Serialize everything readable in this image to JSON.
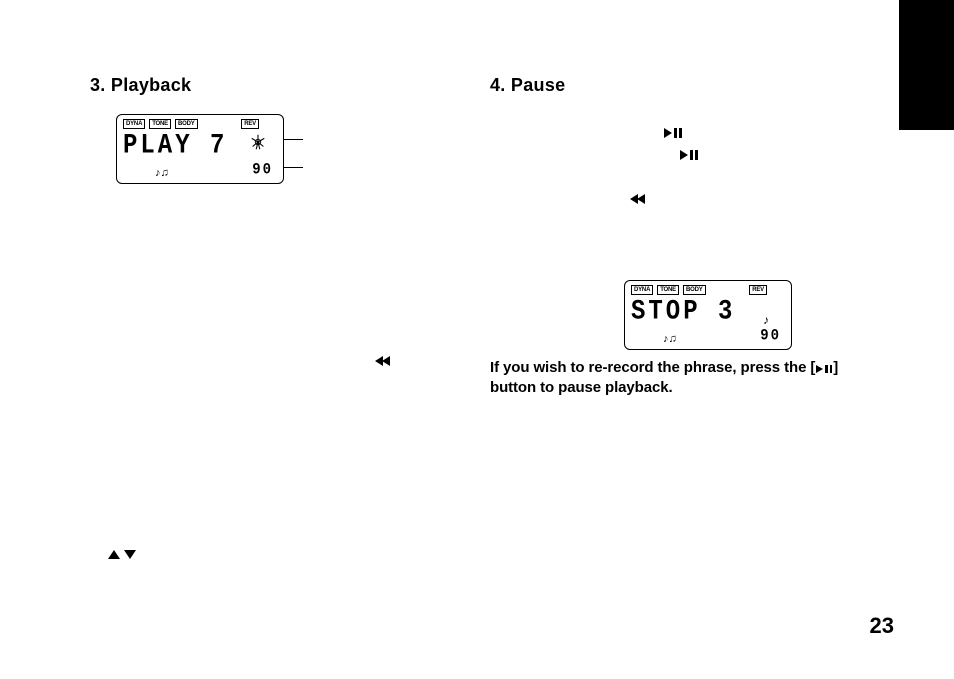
{
  "page_number": "23",
  "left": {
    "heading": "3. Playback",
    "lcd": {
      "tags": [
        "DYNA",
        "TONE",
        "BODY"
      ],
      "rev": "REV",
      "main": "PLAY 7",
      "bpm": "90"
    }
  },
  "right": {
    "heading": "4. Pause",
    "lcd": {
      "tags": [
        "DYNA",
        "TONE",
        "BODY"
      ],
      "rev": "REV",
      "main": "STOP 3",
      "bpm": "90"
    },
    "body_pre": "If you wish to re-record the phrase, press the [",
    "body_post": "] button to pause playback."
  },
  "icons": {
    "play_pause": "play-pause-icon",
    "rewind": "rewind-icon",
    "up_down": "up-down-icon"
  }
}
